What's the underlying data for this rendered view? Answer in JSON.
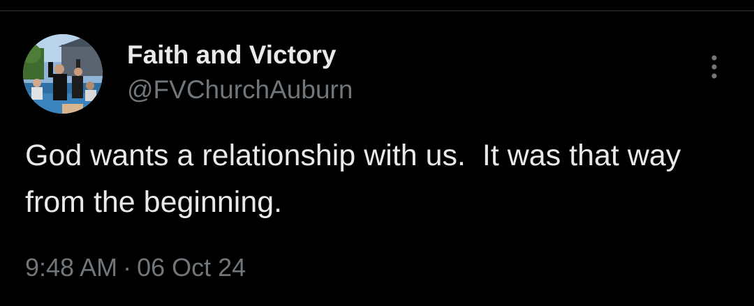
{
  "tweet": {
    "author": {
      "display_name": "Faith and Victory",
      "handle": "@FVChurchAuburn",
      "avatar_icon": "avatar-photo"
    },
    "text": "God wants a relationship with us.  It was that way from the beginning.",
    "time": "9:48 AM",
    "separator": "·",
    "date": "06 Oct 24",
    "more_icon": "more-vertical-icon"
  },
  "colors": {
    "background": "#000000",
    "primary_text": "#e7e9ea",
    "secondary_text": "#71767b",
    "divider": "#2f3336"
  }
}
